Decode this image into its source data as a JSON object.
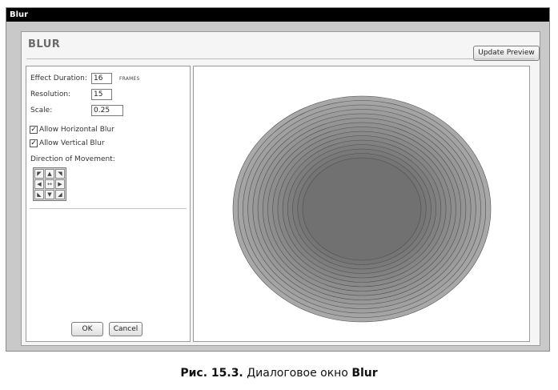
{
  "window": {
    "title": "Blur"
  },
  "dialog": {
    "heading": "BLUR",
    "update_preview_label": "Update Preview",
    "fields": {
      "duration_label": "Effect Duration:",
      "duration_value": "16",
      "duration_unit": "FRAMES",
      "resolution_label": "Resolution:",
      "resolution_value": "15",
      "scale_label": "Scale:",
      "scale_value": "0.25"
    },
    "checkboxes": {
      "horizontal_label": "Allow Horizontal Blur",
      "horizontal_checked": true,
      "vertical_label": "Allow Vertical Blur",
      "vertical_checked": true
    },
    "direction_label": "Direction of Movement:",
    "direction_cells": [
      "◤",
      "▲",
      "◥",
      "◀",
      "↔",
      "▶",
      "◣",
      "▼",
      "◢"
    ],
    "ok_label": "OK",
    "cancel_label": "Cancel"
  },
  "caption": {
    "prefix": "Рис. 15.3.",
    "text": " Диалоговое окно ",
    "name": "Blur"
  }
}
